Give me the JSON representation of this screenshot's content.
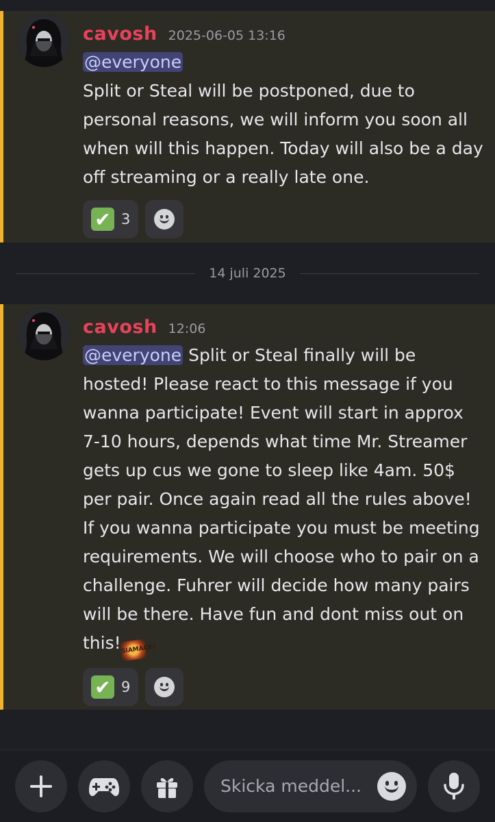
{
  "messages": [
    {
      "author": "cavosh",
      "timestamp": "2025-06-05 13:16",
      "mention": "@everyone",
      "text": "Split or Steal will be postponed, due to personal reasons, we will inform you soon all when will this happen. Today will also be a day off streaming or a really late one.",
      "reaction": {
        "emoji": "✔",
        "count": "3"
      }
    },
    {
      "author": "cavosh",
      "timestamp": "12:06",
      "mention": "@everyone",
      "text": " Split or Steal finally will be hosted! Please react to this message if you wanna participate! Event will start in approx 7-10 hours, depends what time Mr. Streamer gets up cus we gone to sleep like 4am. 50$ per pair. Once again read all the rules above! If you wanna participate you must be meeting requirements. We will choose who to pair on a challenge. Fuhrer will decide how many pairs will be there. Have fun and dont miss out on this!",
      "sticker_text": "SIAMACK!",
      "reaction": {
        "emoji": "✔",
        "count": "9"
      }
    }
  ],
  "date_divider": "14 juli 2025",
  "composer": {
    "placeholder": "Skicka meddel..."
  },
  "colors": {
    "accent_bar": "#f0b232",
    "author": "#e8425a",
    "mention_bg": "#414474",
    "check_green": "#77b255"
  },
  "icons": [
    "avatar",
    "check-icon",
    "add-reaction-icon",
    "plus-icon",
    "gamepad-icon",
    "gift-icon",
    "emoji-icon",
    "microphone-icon"
  ]
}
